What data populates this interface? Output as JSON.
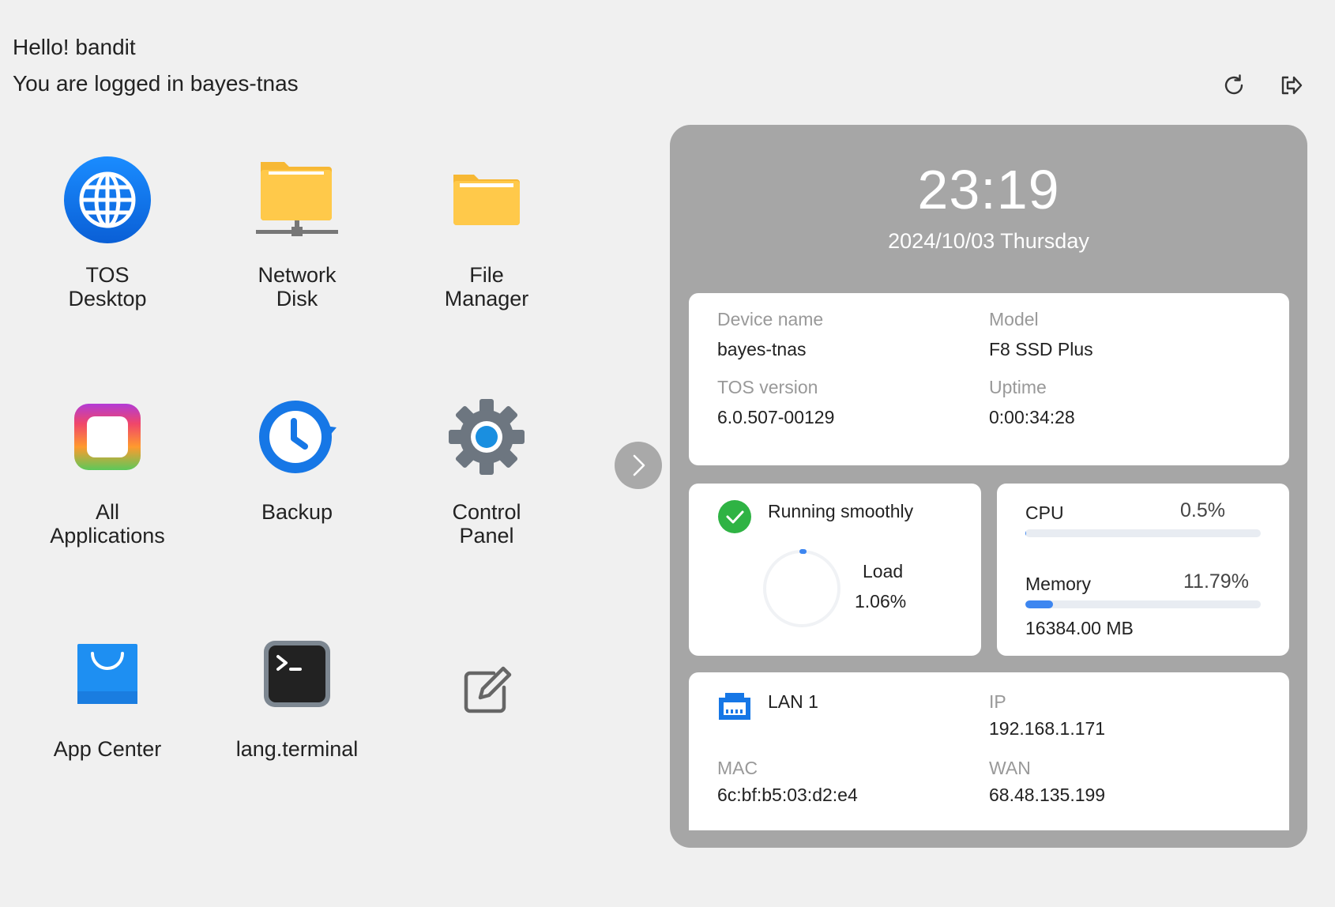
{
  "header": {
    "greeting": "Hello! bandit",
    "login_status": "You are logged in bayes-tnas"
  },
  "icons": {
    "refresh": "refresh-icon",
    "logout": "logout-icon",
    "expand": "chevron-right-icon"
  },
  "apps": [
    {
      "label": "TOS\nDesktop",
      "icon": "globe-icon"
    },
    {
      "label": "Network\nDisk",
      "icon": "network-folder-icon"
    },
    {
      "label": "File\nManager",
      "icon": "folder-icon"
    },
    {
      "label": "All\nApplications",
      "icon": "all-apps-icon"
    },
    {
      "label": "Backup",
      "icon": "backup-clock-icon"
    },
    {
      "label": "Control\nPanel",
      "icon": "gear-icon"
    },
    {
      "label": "App Center",
      "icon": "shopping-bag-icon"
    },
    {
      "label": "lang.terminal",
      "icon": "terminal-icon"
    },
    {
      "label": "",
      "icon": "edit-icon"
    }
  ],
  "panel": {
    "time": "23:19",
    "date": "2024/10/03 Thursday",
    "device": {
      "device_name_label": "Device name",
      "device_name": "bayes-tnas",
      "model_label": "Model",
      "model": "F8 SSD Plus",
      "tos_version_label": "TOS version",
      "tos_version": "6.0.507-00129",
      "uptime_label": "Uptime",
      "uptime": "0:00:34:28"
    },
    "status": {
      "text": "Running smoothly",
      "load_label": "Load",
      "load_value": "1.06%",
      "load_fraction": 0.0106
    },
    "resources": {
      "cpu_label": "CPU",
      "cpu_value": "0.5%",
      "cpu_fraction": 0.005,
      "memory_label": "Memory",
      "memory_value": "11.79%",
      "memory_fraction": 0.1179,
      "memory_total": "16384.00 MB"
    },
    "network": {
      "lan_label": "LAN 1",
      "ip_label": "IP",
      "ip": "192.168.1.171",
      "mac_label": "MAC",
      "mac": "6c:bf:b5:03:d2:e4",
      "wan_label": "WAN",
      "wan": "68.48.135.199"
    }
  },
  "colors": {
    "background": "#f0f0f0",
    "panel": "#a6a6a6",
    "accent": "#3d86f0",
    "ok_green": "#2fb344"
  }
}
